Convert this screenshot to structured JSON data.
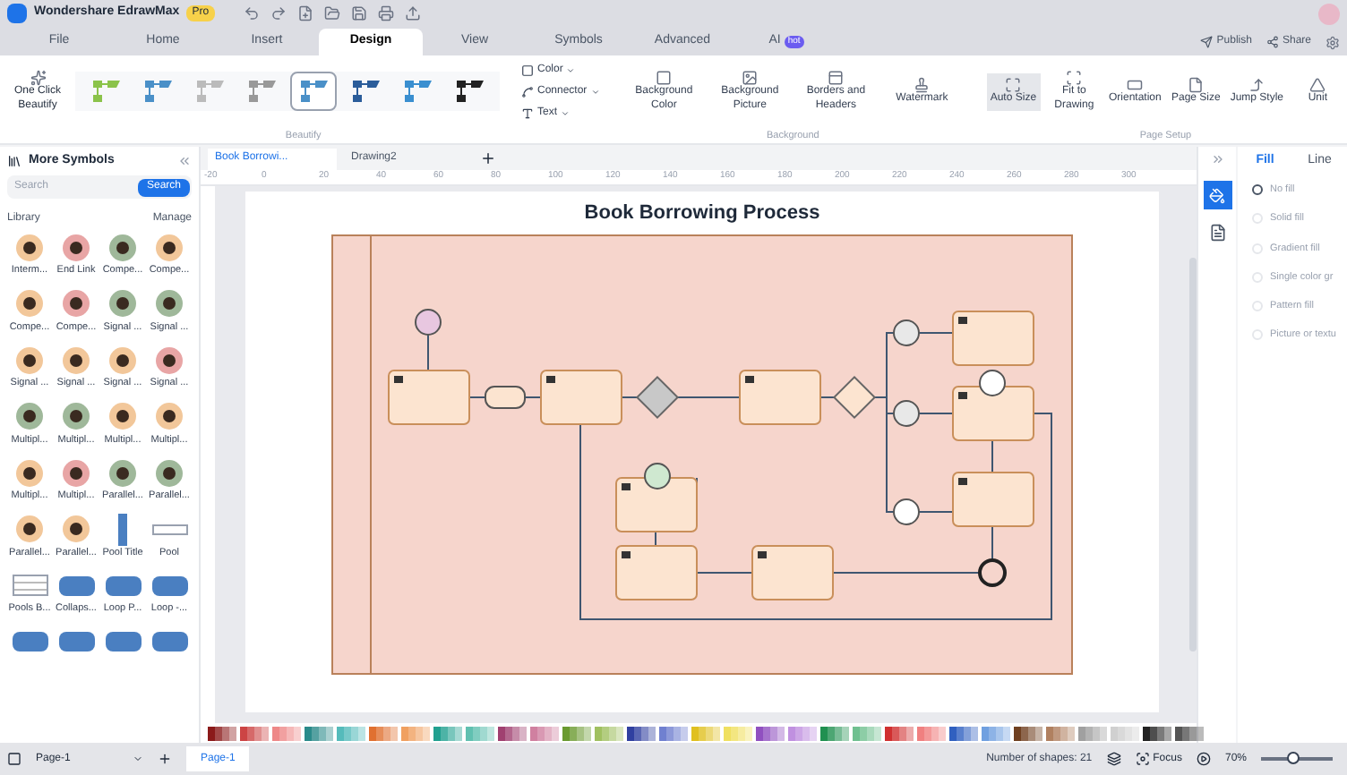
{
  "app": {
    "name": "Wondershare EdrawMax",
    "badge": "Pro"
  },
  "menu_tabs": [
    {
      "label": "File",
      "selected": false
    },
    {
      "label": "Home",
      "selected": false
    },
    {
      "label": "Insert",
      "selected": false
    },
    {
      "label": "Design",
      "selected": true
    },
    {
      "label": "View",
      "selected": false
    },
    {
      "label": "Symbols",
      "selected": false
    },
    {
      "label": "Advanced",
      "selected": false
    },
    {
      "label": "AI",
      "selected": false,
      "badge": "hot"
    }
  ],
  "header_actions": [
    {
      "kind": "publish",
      "label": "Publish"
    },
    {
      "kind": "share",
      "label": "Share"
    }
  ],
  "ribbon": {
    "beautify": {
      "button": "One Click Beautify",
      "styles": [
        {
          "selected": false
        },
        {
          "selected": false
        },
        {
          "selected": false
        },
        {
          "selected": false
        },
        {
          "selected": true
        },
        {
          "selected": false
        },
        {
          "selected": false
        },
        {
          "selected": false
        }
      ],
      "options": [
        {
          "kind": "color",
          "label": "Color"
        },
        {
          "kind": "connector",
          "label": "Connector"
        },
        {
          "kind": "text",
          "label": "Text"
        }
      ],
      "label": "Beautify"
    },
    "background": {
      "buttons": [
        {
          "kind": "color",
          "label": "Background Color"
        },
        {
          "kind": "picture",
          "label": "Background Picture"
        },
        {
          "kind": "borders",
          "label": "Borders and Headers"
        },
        {
          "kind": "watermark",
          "label": "Watermark"
        }
      ],
      "label": "Background"
    },
    "page_setup": {
      "buttons": [
        {
          "kind": "autosize",
          "label": "Auto Size",
          "selected": true
        },
        {
          "kind": "fit",
          "label": "Fit to Drawing",
          "selected": false
        },
        {
          "kind": "orientation",
          "label": "Orientation",
          "selected": false
        },
        {
          "kind": "pagesize",
          "label": "Page Size",
          "selected": false
        },
        {
          "kind": "jump",
          "label": "Jump Style",
          "selected": false
        },
        {
          "kind": "unit",
          "label": "Unit",
          "selected": false
        }
      ],
      "label": "Page Setup"
    }
  },
  "sidebar": {
    "title": "More Symbols",
    "search": {
      "placeholder": "Search",
      "button": "Search"
    },
    "library": "Library",
    "manage": "Manage",
    "symbols": [
      {
        "kind": "event",
        "color": "#f2c79a",
        "label": "Interm..."
      },
      {
        "kind": "event",
        "color": "#e8a5a5",
        "label": "End Link"
      },
      {
        "kind": "event",
        "color": "#9fb89a",
        "label": "Compe..."
      },
      {
        "kind": "event",
        "color": "#f2c79a",
        "label": "Compe..."
      },
      {
        "kind": "event",
        "color": "#f2c79a",
        "label": "Compe..."
      },
      {
        "kind": "event",
        "color": "#e8a5a5",
        "label": "Compe..."
      },
      {
        "kind": "event",
        "color": "#9fb89a",
        "label": "Signal ..."
      },
      {
        "kind": "event",
        "color": "#9fb89a",
        "label": "Signal ..."
      },
      {
        "kind": "event",
        "color": "#f2c79a",
        "label": "Signal ..."
      },
      {
        "kind": "event",
        "color": "#f2c79a",
        "label": "Signal ..."
      },
      {
        "kind": "event",
        "color": "#f2c79a",
        "label": "Signal ..."
      },
      {
        "kind": "event",
        "color": "#e8a5a5",
        "label": "Signal ..."
      },
      {
        "kind": "event",
        "color": "#9fb89a",
        "label": "Multipl..."
      },
      {
        "kind": "event",
        "color": "#9fb89a",
        "label": "Multipl..."
      },
      {
        "kind": "event",
        "color": "#f2c79a",
        "label": "Multipl..."
      },
      {
        "kind": "event",
        "color": "#f2c79a",
        "label": "Multipl..."
      },
      {
        "kind": "event",
        "color": "#f2c79a",
        "label": "Multipl..."
      },
      {
        "kind": "event",
        "color": "#e8a5a5",
        "label": "Multipl..."
      },
      {
        "kind": "event",
        "color": "#9fb89a",
        "label": "Parallel..."
      },
      {
        "kind": "event",
        "color": "#9fb89a",
        "label": "Parallel..."
      },
      {
        "kind": "event",
        "color": "#f2c79a",
        "label": "Parallel..."
      },
      {
        "kind": "event",
        "color": "#f2c79a",
        "label": "Parallel..."
      },
      {
        "kind": "pooltitle",
        "label": "Pool Title"
      },
      {
        "kind": "pool",
        "label": "Pool"
      },
      {
        "kind": "lanes",
        "label": "Pools B..."
      },
      {
        "kind": "block",
        "label": "Collaps..."
      },
      {
        "kind": "block",
        "label": "Loop P..."
      },
      {
        "kind": "block",
        "label": "Loop -..."
      },
      {
        "kind": "block"
      },
      {
        "kind": "block"
      },
      {
        "kind": "block"
      },
      {
        "kind": "block"
      }
    ]
  },
  "doc_tabs": [
    {
      "label": "Book Borrowi...",
      "selected": true
    },
    {
      "label": "Drawing2",
      "selected": false
    }
  ],
  "ruler": [
    "-20",
    "0",
    "20",
    "40",
    "60",
    "80",
    "100",
    "120",
    "140",
    "160",
    "180",
    "200",
    "220",
    "240",
    "260",
    "280",
    "300"
  ],
  "diagram": {
    "title": "Book Borrowing Process"
  },
  "properties": {
    "tabs": [
      {
        "label": "Fill",
        "selected": true
      },
      {
        "label": "Line",
        "selected": false
      }
    ],
    "options": [
      {
        "label": "No fill",
        "selected": true
      },
      {
        "label": "Solid fill",
        "selected": false
      },
      {
        "label": "Gradient fill",
        "selected": false
      },
      {
        "label": "Single color gr",
        "selected": false
      },
      {
        "label": "Pattern fill",
        "selected": false
      },
      {
        "label": "Picture or textu",
        "selected": false
      }
    ]
  },
  "status": {
    "page_select": "Page-1",
    "page_tab": "Page-1",
    "shapes": "Number of shapes: 21",
    "focus": "Focus",
    "zoom": "70%",
    "level": 0.45
  }
}
